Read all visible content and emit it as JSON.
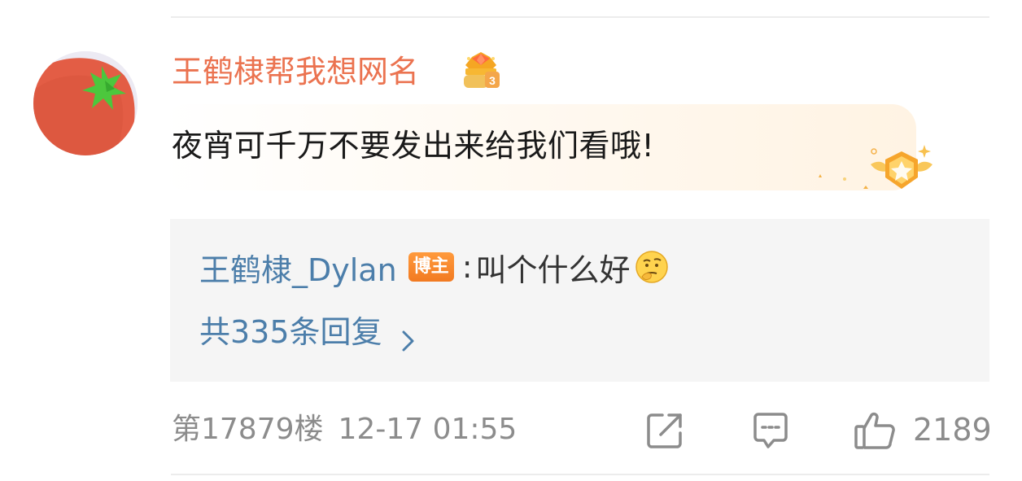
{
  "comment": {
    "username": "王鹤棣帮我想网名",
    "text": "夜宵可千万不要发出来给我们看哦!",
    "crown_badge_icon": "crown-level-3-icon",
    "medal_icon": "winged-star-medal-icon"
  },
  "reply": {
    "author": "王鹤棣_Dylan",
    "host_badge": "博主",
    "separator": ":",
    "text": "叫个什么好",
    "emoji_icon": "thinking-emoji-icon",
    "more_label": "共335条回复"
  },
  "meta": {
    "floor": "第17879楼",
    "time": "12-17 01:55"
  },
  "actions": {
    "share_icon": "share-icon",
    "comment_icon": "comment-icon",
    "like_icon": "thumbs-up-icon",
    "like_count": "2189"
  },
  "colors": {
    "username": "#eb7350",
    "link_blue": "#4c7eaa",
    "meta_gray": "#8c8c8c",
    "reply_bg": "#f5f5f5",
    "host_badge": "#f27a21"
  }
}
